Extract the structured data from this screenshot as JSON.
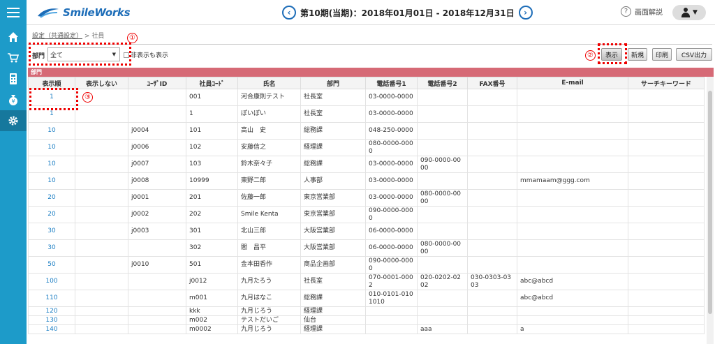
{
  "header": {
    "logo_text": "SmileWorks",
    "period_label": "第10期(当期)：2018年01月01日 - 2018年12月31日",
    "help_label": "画面解説"
  },
  "sidebar": {
    "items": [
      {
        "icon": "home-icon"
      },
      {
        "icon": "cart-icon"
      },
      {
        "icon": "calculator-icon"
      },
      {
        "icon": "money-bag-icon"
      },
      {
        "icon": "gear-icon",
        "active": true
      }
    ]
  },
  "breadcrumb": {
    "link": "設定（共通設定）",
    "separator": ">",
    "current": "社員"
  },
  "filter": {
    "dept_label": "部門",
    "dept_value": "全て",
    "show_hidden_label": "非表示も表示"
  },
  "annotations": {
    "one": "①",
    "two": "②",
    "three": "③"
  },
  "buttons": {
    "show": "表示",
    "new": "新規",
    "print": "印刷",
    "csv": "CSV出力"
  },
  "group_label": "部門",
  "table": {
    "headers": [
      "表示順",
      "表示しない",
      "ﾕｰｻﾞID",
      "社員ｺｰﾄﾞ",
      "氏名",
      "部門",
      "電話番号1",
      "電話番号2",
      "FAX番号",
      "E-mail",
      "サーチキーワード"
    ],
    "rows": [
      [
        "1",
        "",
        "",
        "001",
        "河合康則テスト",
        "社長室",
        "03-0000-0000",
        "",
        "",
        "",
        ""
      ],
      [
        "1",
        "",
        "",
        "1",
        "ぽいぽい",
        "社長室",
        "03-0000-0000",
        "",
        "",
        "",
        ""
      ],
      [
        "10",
        "",
        "j0004",
        "101",
        "高山　史",
        "総務課",
        "048-250-0000",
        "",
        "",
        "",
        ""
      ],
      [
        "10",
        "",
        "j0006",
        "102",
        "安藤信之",
        "経理課",
        "080-0000-0000",
        "",
        "",
        "",
        ""
      ],
      [
        "10",
        "",
        "j0007",
        "103",
        "鈴木奈々子",
        "総務課",
        "03-0000-0000",
        "090-0000-0000",
        "",
        "",
        ""
      ],
      [
        "10",
        "",
        "j0008",
        "10999",
        "東野二郎",
        "人事部",
        "03-0000-0000",
        "",
        "",
        "mmamaam@ggg.com",
        ""
      ],
      [
        "20",
        "",
        "j0001",
        "201",
        "佐藤一郎",
        "東京営業部",
        "03-0000-0000",
        "080-0000-0000",
        "",
        "",
        ""
      ],
      [
        "20",
        "",
        "j0002",
        "202",
        "Smile Kenta",
        "東京営業部",
        "090-0000-0000",
        "",
        "",
        "",
        ""
      ],
      [
        "30",
        "",
        "j0003",
        "301",
        "北山三郎",
        "大阪営業部",
        "06-0000-0000",
        "",
        "",
        "",
        ""
      ],
      [
        "30",
        "",
        "",
        "302",
        "閻　昌平",
        "大阪営業部",
        "06-0000-0000",
        "080-0000-0000",
        "",
        "",
        ""
      ],
      [
        "50",
        "",
        "j0010",
        "501",
        "金本田香作",
        "商品企画部",
        "090-0000-0000",
        "",
        "",
        "",
        ""
      ],
      [
        "100",
        "",
        "",
        "j0012",
        "九月たろう",
        "社長室",
        "070-0001-0002",
        "020-0202-0202",
        "030-0303-0303",
        "abc@abcd",
        ""
      ],
      [
        "110",
        "",
        "",
        "m001",
        "九月はなこ",
        "総務課",
        "010-0101-0101010",
        "",
        "",
        "abc@abcd",
        ""
      ],
      [
        "120",
        "",
        "",
        "kkk",
        "九月じろう",
        "経理課",
        "",
        "",
        "",
        "",
        ""
      ],
      [
        "130",
        "",
        "",
        "m002",
        "テストだいご",
        "仙台",
        "",
        "",
        "",
        "",
        ""
      ],
      [
        "140",
        "",
        "",
        "m0002",
        "九月じろう",
        "経理課",
        "",
        "aaa",
        "",
        "a",
        ""
      ]
    ]
  }
}
